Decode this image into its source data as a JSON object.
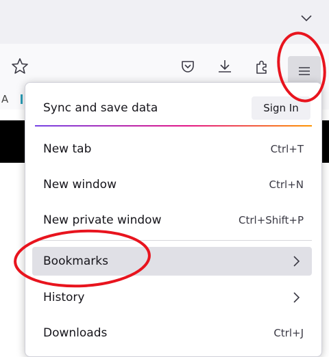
{
  "toolbar": {
    "icons": [
      "tab-list-chevron-icon",
      "bookmark-star-icon",
      "pocket-icon",
      "downloads-icon",
      "extensions-icon",
      "hamburger-menu-icon"
    ],
    "bookmarks_fragment": "A"
  },
  "app_menu": {
    "sync_label": "Sync and save data",
    "sign_in_label": "Sign In",
    "items": [
      {
        "label": "New tab",
        "shortcut": "Ctrl+T"
      },
      {
        "label": "New window",
        "shortcut": "Ctrl+N"
      },
      {
        "label": "New private window",
        "shortcut": "Ctrl+Shift+P"
      },
      {
        "label": "Bookmarks",
        "shortcut": "",
        "submenu": true,
        "highlighted": true
      },
      {
        "label": "History",
        "shortcut": "",
        "submenu": true
      },
      {
        "label": "Downloads",
        "shortcut": "Ctrl+J"
      }
    ]
  },
  "colors": {
    "annotation": "#e8141e",
    "menu_hover": "#e0e0e6",
    "gradient": [
      "#7542e5",
      "#e31587",
      "#ff9500"
    ]
  }
}
